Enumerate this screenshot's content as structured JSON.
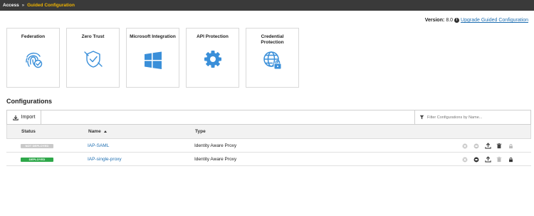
{
  "breadcrumb": {
    "root": "Access",
    "separator": "»",
    "current": "Guided Configuration"
  },
  "version": {
    "label": "Version:",
    "value": "8.0",
    "upgrade_link": "Upgrade Guided Configuration"
  },
  "tiles": [
    {
      "label": "Federation",
      "icon": "fingerprint-icon"
    },
    {
      "label": "Zero Trust",
      "icon": "shield-check-icon"
    },
    {
      "label": "Microsoft Integration",
      "icon": "windows-logo-icon"
    },
    {
      "label": "API Protection",
      "icon": "gear-icon"
    },
    {
      "label": "Credential Protection",
      "icon": "globe-lock-icon"
    }
  ],
  "configurations": {
    "title": "Configurations",
    "import_label": "Import",
    "filter_placeholder": "Filter Configurations by Name...",
    "columns": {
      "status": "Status",
      "name": "Name",
      "type": "Type"
    },
    "rows": [
      {
        "status": "NOT DEPLOYED",
        "status_color": "#c9c9c9",
        "name": "IAP-SAML",
        "type": "Identity Aware Proxy"
      },
      {
        "status": "DEPLOYED",
        "status_color": "#2ea84a",
        "name": "IAP-single-proxy",
        "type": "Identity Aware Proxy"
      }
    ]
  },
  "colors": {
    "accent": "#3a8fd9",
    "link": "#1f6fb2",
    "breadcrumb_current": "#f0b400",
    "topbar": "#3a3a3a"
  }
}
